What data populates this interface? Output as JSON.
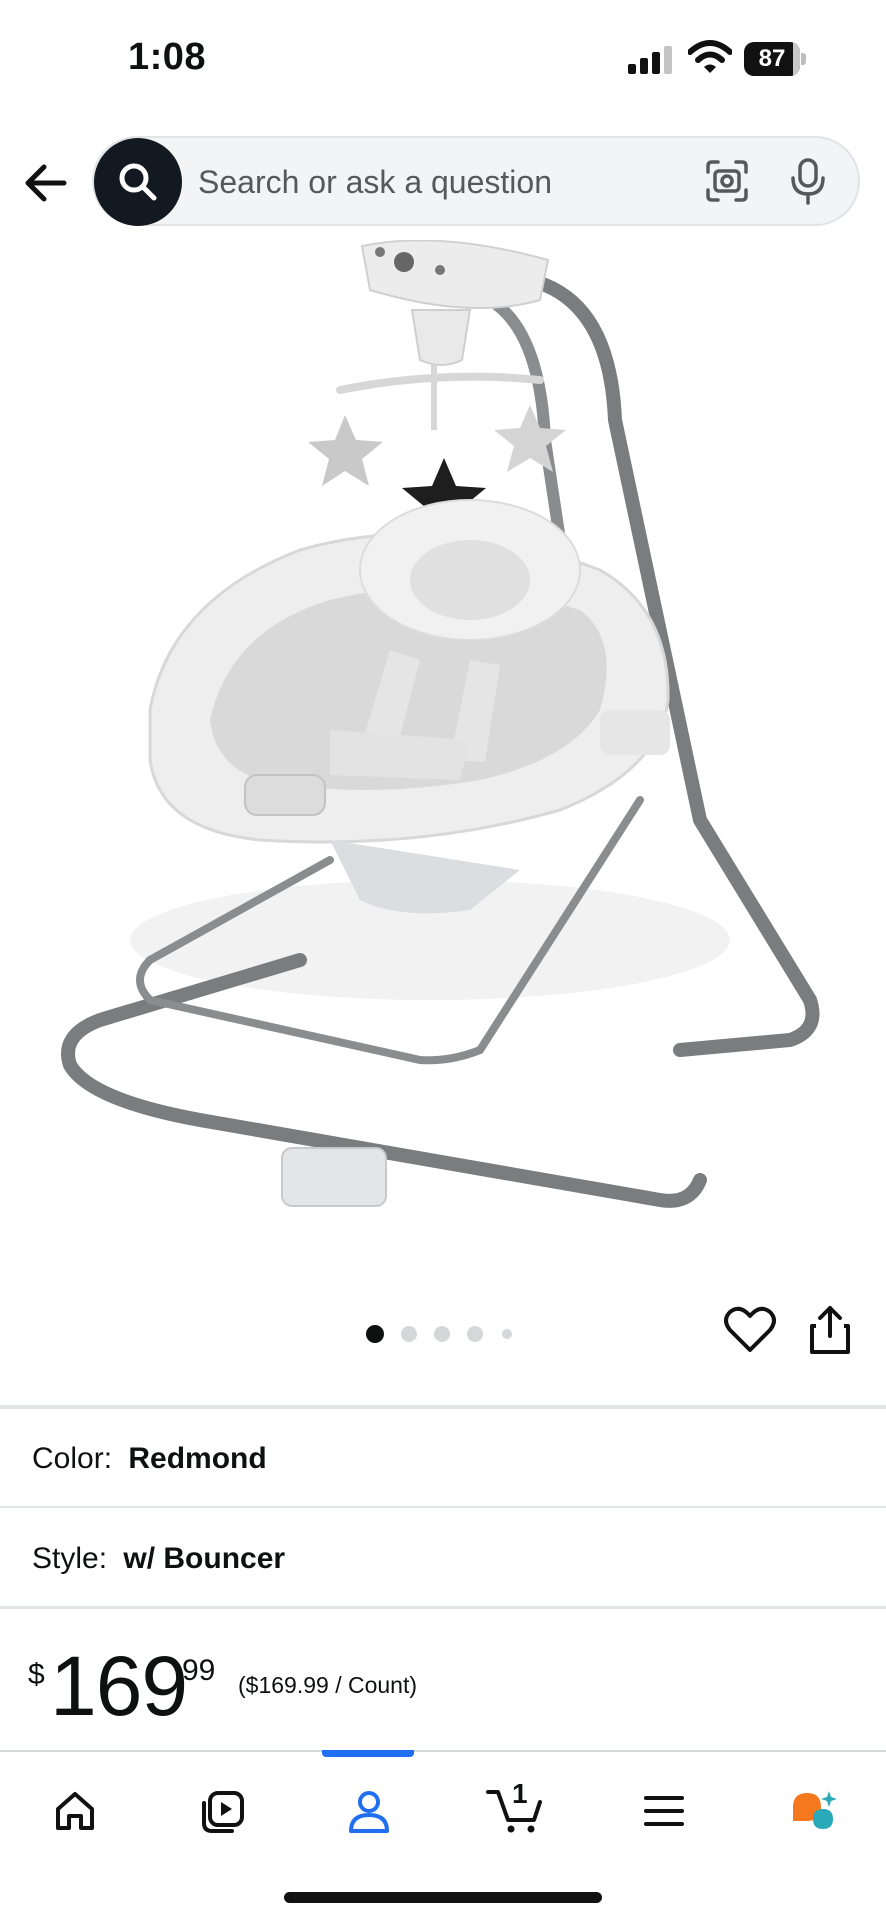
{
  "status_bar": {
    "time": "1:08",
    "battery_level": "87",
    "signal_bars": 3,
    "wifi": true
  },
  "search": {
    "placeholder": "Search or ask a question"
  },
  "carousel": {
    "total_images": 5,
    "active_index": 0
  },
  "variations": {
    "color": {
      "label": "Color:",
      "value": "Redmond"
    },
    "style": {
      "label": "Style:",
      "value": "w/ Bouncer"
    }
  },
  "price": {
    "currency_symbol": "$",
    "whole": "169",
    "fraction": "99",
    "per_unit": "($169.99 / Count)"
  },
  "bottom_nav": {
    "active_tab": "you",
    "cart_count": "1",
    "accent_color": "#1f6ff0"
  },
  "icons": [
    "back-arrow-icon",
    "search-icon",
    "camera-lens-icon",
    "microphone-icon",
    "heart-icon",
    "share-icon",
    "home-icon",
    "video-icon",
    "user-icon",
    "cart-icon",
    "menu-icon",
    "ai-assistant-icon"
  ]
}
